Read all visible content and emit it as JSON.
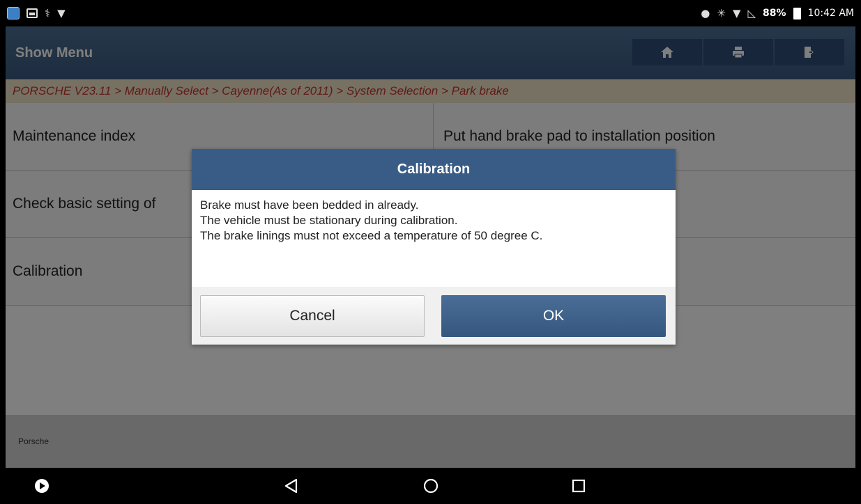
{
  "status_bar": {
    "battery": "88%",
    "time": "10:42 AM"
  },
  "app_bar": {
    "title": "Show Menu"
  },
  "breadcrumb": "PORSCHE V23.11 > Manually Select > Cayenne(As of 2011) > System Selection > Park brake",
  "menu": {
    "items": [
      {
        "label": "Maintenance index"
      },
      {
        "label": "Put hand brake pad to installation position"
      },
      {
        "label": "Check basic setting of"
      },
      {
        "label": ""
      },
      {
        "label": "Calibration"
      },
      {
        "label": ""
      }
    ]
  },
  "footer": {
    "text": "Porsche"
  },
  "dialog": {
    "title": "Calibration",
    "lines": [
      "Brake must have been bedded in already.",
      "The vehicle must be stationary during calibration.",
      "The brake linings must not exceed a temperature of 50 degree C."
    ],
    "cancel_label": "Cancel",
    "ok_label": "OK"
  },
  "colors": {
    "app_bar": "#3b5a80",
    "breadcrumb_text": "#c2352b",
    "breadcrumb_bg": "#efe3c8",
    "dialog_header": "#395c87",
    "ok_button": "#35577f"
  }
}
